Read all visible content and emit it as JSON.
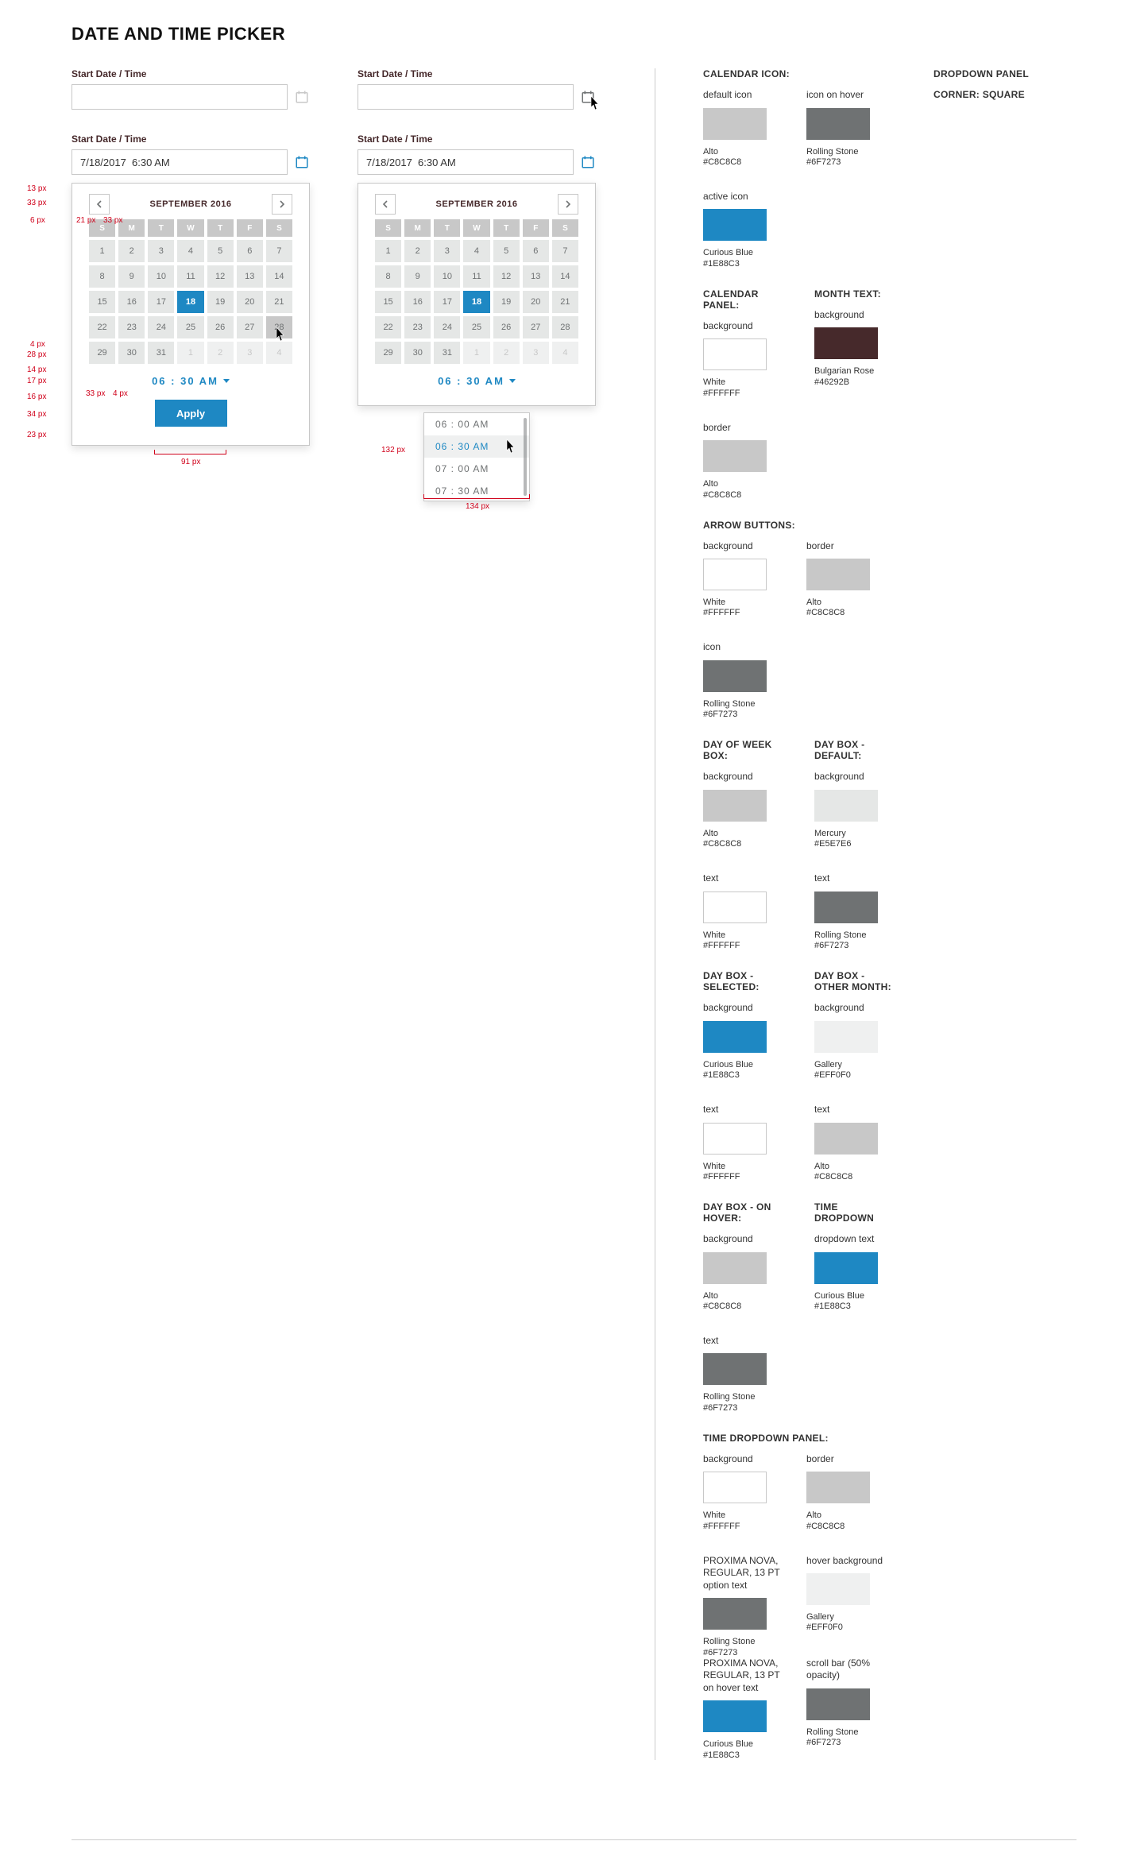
{
  "title": "DATE AND TIME PICKER",
  "fieldLabel": "Start Date / Time",
  "inputValue": "7/18/2017  6:30 AM",
  "month": "SEPTEMBER 2016",
  "dow": [
    "S",
    "M",
    "T",
    "W",
    "T",
    "F",
    "S"
  ],
  "weeks": [
    [
      {
        "d": "1",
        "t": "d"
      },
      {
        "d": "2",
        "t": "d"
      },
      {
        "d": "3",
        "t": "d"
      },
      {
        "d": "4",
        "t": "d"
      },
      {
        "d": "5",
        "t": "d"
      },
      {
        "d": "6",
        "t": "d"
      },
      {
        "d": "7",
        "t": "d"
      }
    ],
    [
      {
        "d": "8",
        "t": "d"
      },
      {
        "d": "9",
        "t": "d"
      },
      {
        "d": "10",
        "t": "d"
      },
      {
        "d": "11",
        "t": "d"
      },
      {
        "d": "12",
        "t": "d"
      },
      {
        "d": "13",
        "t": "d"
      },
      {
        "d": "14",
        "t": "d"
      }
    ],
    [
      {
        "d": "15",
        "t": "d"
      },
      {
        "d": "16",
        "t": "d"
      },
      {
        "d": "17",
        "t": "d"
      },
      {
        "d": "18",
        "t": "s"
      },
      {
        "d": "19",
        "t": "d"
      },
      {
        "d": "20",
        "t": "d"
      },
      {
        "d": "21",
        "t": "d"
      }
    ],
    [
      {
        "d": "22",
        "t": "d"
      },
      {
        "d": "23",
        "t": "d"
      },
      {
        "d": "24",
        "t": "d"
      },
      {
        "d": "25",
        "t": "d"
      },
      {
        "d": "26",
        "t": "d"
      },
      {
        "d": "27",
        "t": "d"
      },
      {
        "d": "28",
        "t": "h"
      }
    ],
    [
      {
        "d": "29",
        "t": "d"
      },
      {
        "d": "30",
        "t": "d"
      },
      {
        "d": "31",
        "t": "d"
      },
      {
        "d": "1",
        "t": "o"
      },
      {
        "d": "2",
        "t": "o"
      },
      {
        "d": "3",
        "t": "o"
      },
      {
        "d": "4",
        "t": "o"
      }
    ]
  ],
  "weeks2": [
    [
      {
        "d": "1",
        "t": "d"
      },
      {
        "d": "2",
        "t": "d"
      },
      {
        "d": "3",
        "t": "d"
      },
      {
        "d": "4",
        "t": "d"
      },
      {
        "d": "5",
        "t": "d"
      },
      {
        "d": "6",
        "t": "d"
      },
      {
        "d": "7",
        "t": "d"
      }
    ],
    [
      {
        "d": "8",
        "t": "d"
      },
      {
        "d": "9",
        "t": "d"
      },
      {
        "d": "10",
        "t": "d"
      },
      {
        "d": "11",
        "t": "d"
      },
      {
        "d": "12",
        "t": "d"
      },
      {
        "d": "13",
        "t": "d"
      },
      {
        "d": "14",
        "t": "d"
      }
    ],
    [
      {
        "d": "15",
        "t": "d"
      },
      {
        "d": "16",
        "t": "d"
      },
      {
        "d": "17",
        "t": "d"
      },
      {
        "d": "18",
        "t": "s"
      },
      {
        "d": "19",
        "t": "d"
      },
      {
        "d": "20",
        "t": "d"
      },
      {
        "d": "21",
        "t": "d"
      }
    ],
    [
      {
        "d": "22",
        "t": "d"
      },
      {
        "d": "23",
        "t": "d"
      },
      {
        "d": "24",
        "t": "d"
      },
      {
        "d": "25",
        "t": "d"
      },
      {
        "d": "26",
        "t": "d"
      },
      {
        "d": "27",
        "t": "d"
      },
      {
        "d": "28",
        "t": "d"
      }
    ],
    [
      {
        "d": "29",
        "t": "d"
      },
      {
        "d": "30",
        "t": "d"
      },
      {
        "d": "31",
        "t": "d"
      },
      {
        "d": "1",
        "t": "o"
      },
      {
        "d": "2",
        "t": "o"
      },
      {
        "d": "3",
        "t": "o"
      },
      {
        "d": "4",
        "t": "o"
      }
    ]
  ],
  "timeDisplay": "06 : 30 AM",
  "applyLabel": "Apply",
  "timeOptions": [
    "06 : 00 AM",
    "06 : 30 AM",
    "07 : 00 AM",
    "07 : 30 AM"
  ],
  "timeHoverIndex": 1,
  "ann": {
    "p13": "13 px",
    "p33": "33 px",
    "p6": "6 px",
    "p21": "21 px",
    "p33b": "33 px",
    "p4": "4 px",
    "p28": "28 px",
    "p14": "14 px",
    "p17": "17 px",
    "p16": "16 px",
    "p34": "34 px",
    "p23": "23 px",
    "p91": "91 px",
    "p33c": "33 px",
    "p4b": "4 px",
    "p132": "132 px",
    "p134": "134 px"
  },
  "cornerNote": {
    "title": "DROPDOWN PANEL",
    "line2": "CORNER:  SQUARE"
  },
  "sections": {
    "calIcon": {
      "title": "CALENDAR ICON:",
      "items": [
        {
          "label": "default icon",
          "color": "#C8C8C8",
          "name": "Alto",
          "hex": "#C8C8C8"
        },
        {
          "label": "icon on hover",
          "color": "#6F7273",
          "name": "Rolling Stone",
          "hex": "#6F7273"
        },
        {
          "label": "active icon",
          "color": "#1E88C3",
          "name": "Curious Blue",
          "hex": "#1E88C3"
        }
      ]
    },
    "calPanel": {
      "title": "CALENDAR PANEL:",
      "items": [
        {
          "label": "background",
          "color": "#FFFFFF",
          "bordered": true,
          "name": "White",
          "hex": "#FFFFFF"
        },
        {
          "label": "border",
          "color": "#C8C8C8",
          "name": "Alto",
          "hex": "#C8C8C8"
        }
      ]
    },
    "monthText": {
      "title": "MONTH TEXT:",
      "items": [
        {
          "label": "background",
          "color": "#46292B",
          "name": "Bulgarian Rose",
          "hex": "#46292B"
        }
      ]
    },
    "arrowBtns": {
      "title": "ARROW BUTTONS:",
      "items": [
        {
          "label": "background",
          "color": "#FFFFFF",
          "bordered": true,
          "name": "White",
          "hex": "#FFFFFF"
        },
        {
          "label": "border",
          "color": "#C8C8C8",
          "name": "Alto",
          "hex": "#C8C8C8"
        },
        {
          "label": "icon",
          "color": "#6F7273",
          "name": "Rolling Stone",
          "hex": "#6F7273"
        }
      ]
    },
    "dowBox": {
      "title": "DAY OF WEEK BOX:",
      "items": [
        {
          "label": "background",
          "color": "#C8C8C8",
          "name": "Alto",
          "hex": "#C8C8C8"
        },
        {
          "label": "text",
          "color": "#FFFFFF",
          "bordered": true,
          "name": "White",
          "hex": "#FFFFFF"
        }
      ]
    },
    "dayDefault": {
      "title": "DAY BOX - DEFAULT:",
      "items": [
        {
          "label": "background",
          "color": "#E5E7E6",
          "name": "Mercury",
          "hex": "#E5E7E6"
        },
        {
          "label": "text",
          "color": "#6F7273",
          "name": "Rolling Stone",
          "hex": "#6F7273"
        }
      ]
    },
    "daySelected": {
      "title": "DAY BOX - SELECTED:",
      "items": [
        {
          "label": "background",
          "color": "#1E88C3",
          "name": "Curious Blue",
          "hex": "#1E88C3"
        },
        {
          "label": "text",
          "color": "#FFFFFF",
          "bordered": true,
          "name": "White",
          "hex": "#FFFFFF"
        }
      ]
    },
    "dayOther": {
      "title": "DAY BOX - OTHER MONTH:",
      "items": [
        {
          "label": "background",
          "color": "#EFF0F0",
          "name": "Gallery",
          "hex": "#EFF0F0"
        },
        {
          "label": "text",
          "color": "#C8C8C8",
          "name": "Alto",
          "hex": "#C8C8C8"
        }
      ]
    },
    "dayHover": {
      "title": "DAY BOX - ON HOVER:",
      "items": [
        {
          "label": "background",
          "color": "#C8C8C8",
          "name": "Alto",
          "hex": "#C8C8C8"
        },
        {
          "label": "text",
          "color": "#6F7273",
          "name": "Rolling Stone",
          "hex": "#6F7273"
        }
      ]
    },
    "timeDropdown": {
      "title": "TIME DROPDOWN",
      "items": [
        {
          "label": "dropdown text",
          "color": "#1E88C3",
          "name": "Curious Blue",
          "hex": "#1E88C3"
        }
      ]
    },
    "timePanel": {
      "title": "TIME DROPDOWN PANEL:",
      "items": [
        {
          "label": "background",
          "color": "#FFFFFF",
          "bordered": true,
          "name": "White",
          "hex": "#FFFFFF"
        },
        {
          "label": "border",
          "color": "#C8C8C8",
          "name": "Alto",
          "hex": "#C8C8C8"
        },
        {
          "label": "PROXIMA NOVA, REGULAR, 13 PT\noption text",
          "color": "#6F7273",
          "name": "Rolling Stone",
          "hex": "#6F7273"
        },
        {
          "label": "hover background",
          "color": "#EFF0F0",
          "name": "Gallery",
          "hex": "#EFF0F0"
        }
      ],
      "items2": [
        {
          "label": "PROXIMA NOVA, REGULAR, 13 PT\non hover text",
          "color": "#1E88C3",
          "name": "Curious Blue",
          "hex": "#1E88C3"
        },
        {
          "label": "scroll bar (50% opacity)",
          "color": "#6F7273",
          "name": "Rolling Stone",
          "hex": "#6F7273"
        }
      ]
    }
  }
}
